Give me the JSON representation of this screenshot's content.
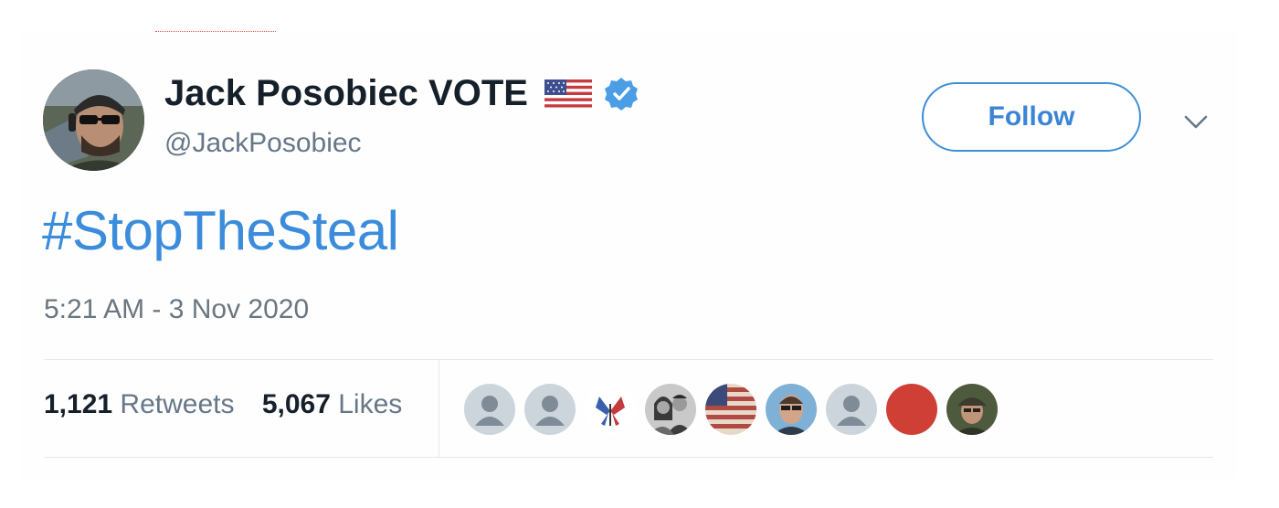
{
  "tweet": {
    "author": {
      "display_name": "Jack Posobiec VOTE",
      "handle": "@JackPosobiec",
      "name_flag_icon": "us-flag-icon",
      "verified_icon": "verified-badge-icon"
    },
    "follow_label": "Follow",
    "more_icon": "chevron-down-icon",
    "text": "#StopTheSteal",
    "timestamp": "5:21 AM - 3 Nov 2020",
    "stats": {
      "retweets_count": "1,121",
      "retweets_label": "Retweets",
      "likes_count": "5,067",
      "likes_label": "Likes"
    },
    "liked_by": [
      "default-avatar-icon",
      "default-avatar-icon",
      "butterfly-flag-avatar",
      "couple-photo-avatar",
      "american-flag-avatar",
      "man-with-sunglasses-avatar",
      "default-avatar-icon",
      "red-circle-avatar",
      "man-with-cap-avatar"
    ]
  },
  "colors": {
    "link_blue": "#3b8ddc",
    "text_dark": "#15202b",
    "text_gray": "#667788",
    "divider": "#e4e9ec"
  }
}
